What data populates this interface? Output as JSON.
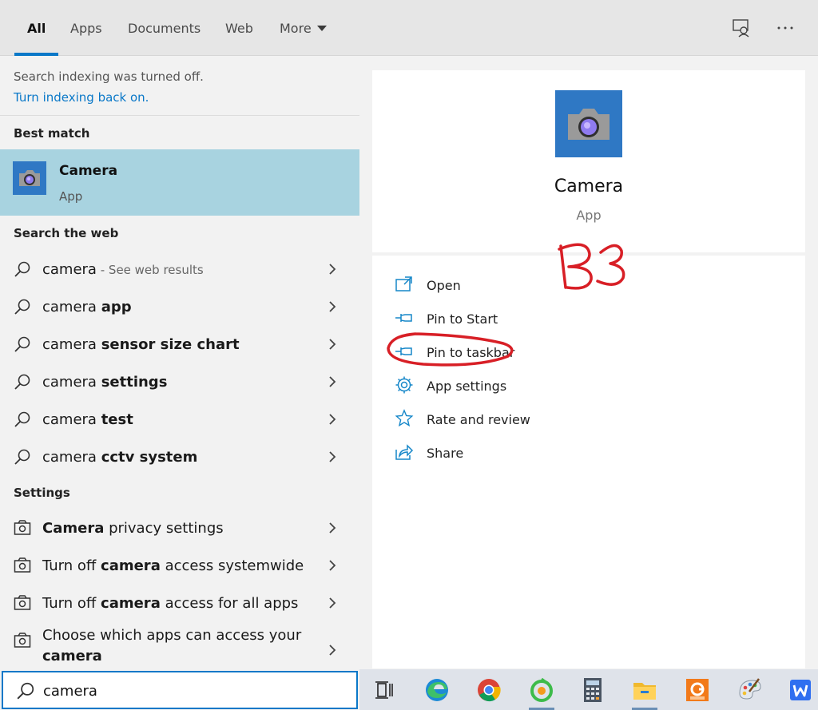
{
  "tabs": [
    {
      "label": "All",
      "active": true
    },
    {
      "label": "Apps"
    },
    {
      "label": "Documents"
    },
    {
      "label": "Web"
    },
    {
      "label": "More"
    }
  ],
  "top_icons": [
    "feedback-icon",
    "more-options-icon"
  ],
  "indexing": {
    "notice": "Search indexing was turned off.",
    "link": "Turn indexing back on."
  },
  "sections": {
    "best_match": "Best match",
    "web": "Search the web",
    "settings": "Settings"
  },
  "best_match": {
    "name": "Camera",
    "type": "App",
    "icon": "camera-icon",
    "icon_color": "#2f78c4"
  },
  "web_results": [
    {
      "prefix": "camera",
      "bold": "",
      "suffix": " - See web results"
    },
    {
      "prefix": "camera ",
      "bold": "app",
      "suffix": ""
    },
    {
      "prefix": "camera ",
      "bold": "sensor size chart",
      "suffix": ""
    },
    {
      "prefix": "camera ",
      "bold": "settings",
      "suffix": ""
    },
    {
      "prefix": "camera ",
      "bold": "test",
      "suffix": ""
    },
    {
      "prefix": "camera ",
      "bold": "cctv system",
      "suffix": ""
    }
  ],
  "settings_results": [
    {
      "pre": "",
      "bold": "Camera",
      "post": " privacy settings"
    },
    {
      "pre": "Turn off ",
      "bold": "camera",
      "post": " access systemwide"
    },
    {
      "pre": "Turn off ",
      "bold": "camera",
      "post": " access for all apps"
    },
    {
      "pre": "Choose which apps can access your ",
      "bold": "camera",
      "post": ""
    }
  ],
  "preview": {
    "name": "Camera",
    "type": "App"
  },
  "actions": [
    {
      "label": "Open",
      "icon": "open-icon"
    },
    {
      "label": "Pin to Start",
      "icon": "pin-icon"
    },
    {
      "label": "Pin to taskbar",
      "icon": "pin-icon"
    },
    {
      "label": "App settings",
      "icon": "gear-icon"
    },
    {
      "label": "Rate and review",
      "icon": "star-icon"
    },
    {
      "label": "Share",
      "icon": "share-icon"
    }
  ],
  "annotation": {
    "text": "B3",
    "color": "#d81f26"
  },
  "search": {
    "value": "camera",
    "placeholder": ""
  },
  "taskbar": [
    "task-view-icon",
    "edge-icon",
    "chrome-icon",
    "app-icon",
    "calculator-icon",
    "file-explorer-icon",
    "pdf-icon",
    "paint-icon",
    "wps-icon"
  ],
  "colors": {
    "accent": "#0a78c8",
    "highlight": "#a8d3e0"
  }
}
